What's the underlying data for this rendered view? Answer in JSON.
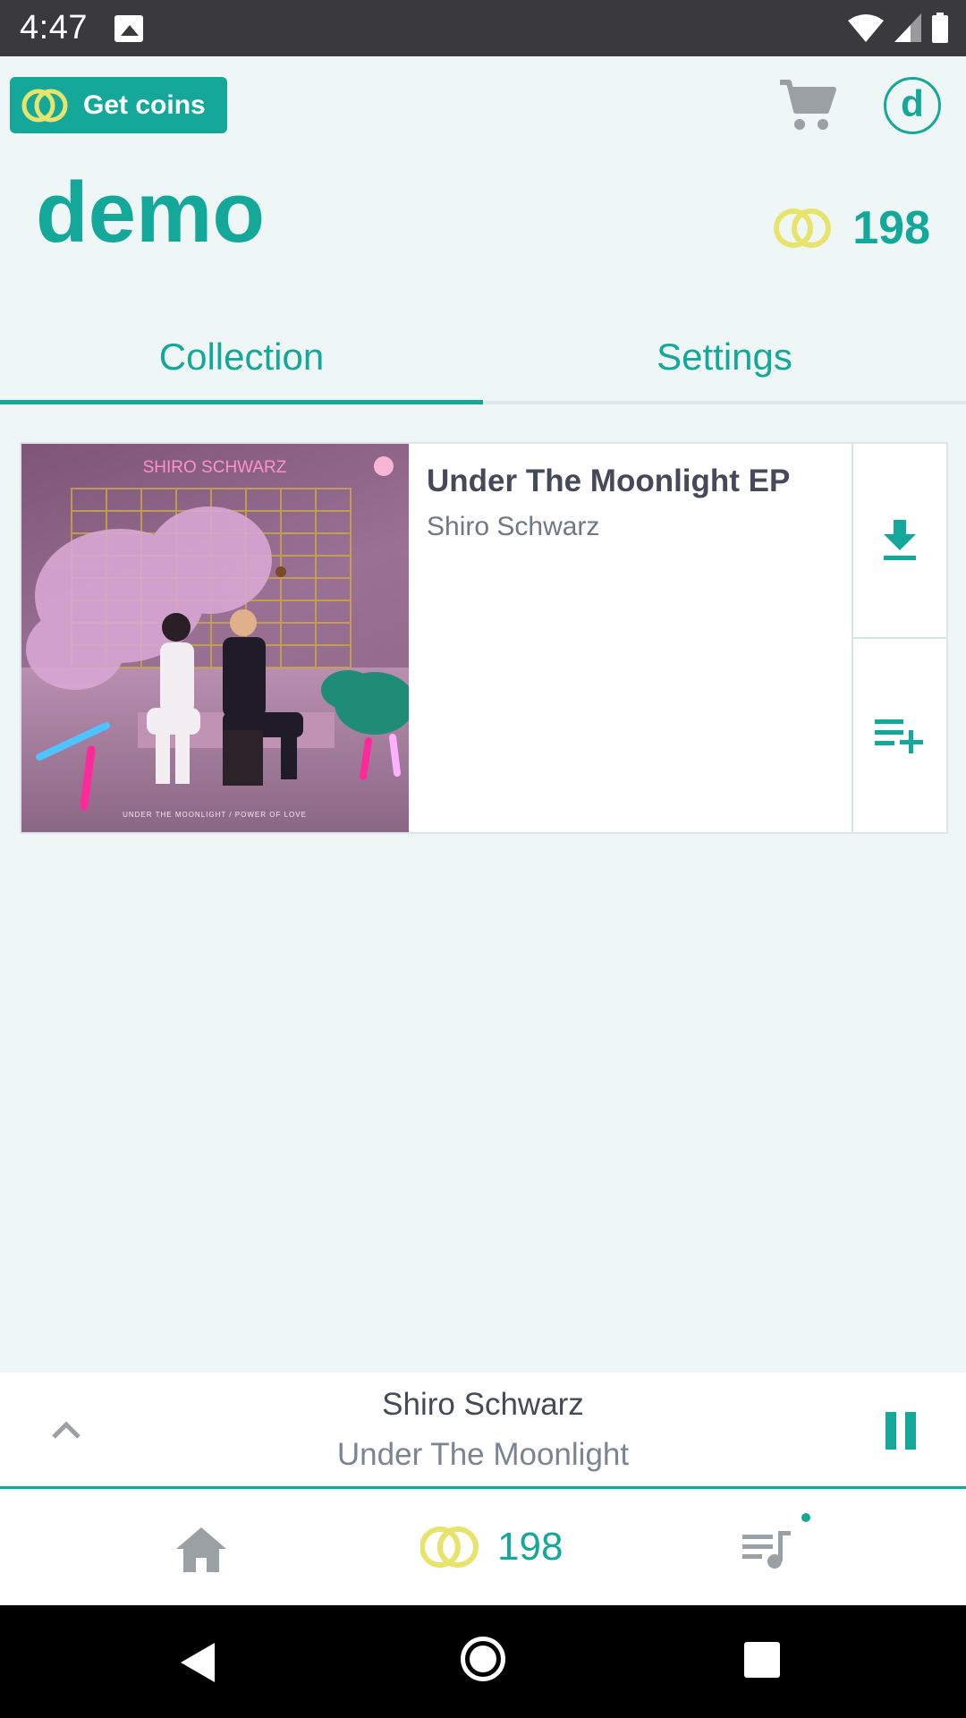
{
  "status_bar": {
    "time": "4:47"
  },
  "header": {
    "get_coins_label": "Get coins",
    "avatar_initial": "d",
    "username": "demo",
    "coin_balance": "198"
  },
  "tabs": [
    {
      "label": "Collection",
      "active": true
    },
    {
      "label": "Settings",
      "active": false
    }
  ],
  "collection": [
    {
      "title": "Under The Moonlight EP",
      "artist": "Shiro Schwarz",
      "cover_text_top": "SHIRO SCHWARZ",
      "cover_text_bottom": "UNDER THE MOONLIGHT / POWER OF LOVE"
    }
  ],
  "player": {
    "artist": "Shiro Schwarz",
    "track": "Under The Moonlight",
    "state": "playing"
  },
  "bottom_nav": {
    "coin_balance": "198",
    "items": [
      "home-icon",
      "coins-icon",
      "queue-icon"
    ]
  },
  "colors": {
    "accent": "#14a89a",
    "coin": "#e8e36a",
    "background": "#eef7f5"
  }
}
